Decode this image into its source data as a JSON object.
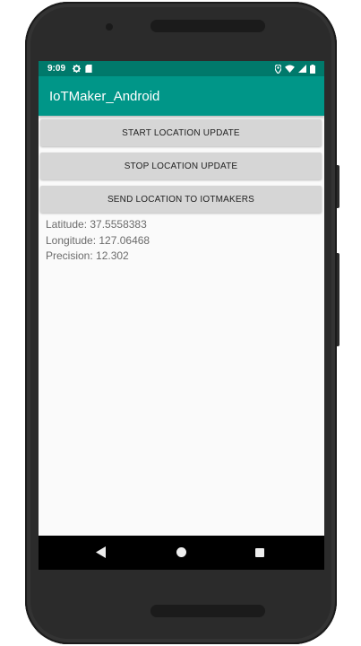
{
  "status_bar": {
    "time": "9:09",
    "left_icons": [
      "gear-icon",
      "sd-card-icon"
    ],
    "right_icons": [
      "location-pin-icon",
      "wifi-icon",
      "cell-signal-icon",
      "battery-icon"
    ]
  },
  "app_bar": {
    "title": "IoTMaker_Android"
  },
  "buttons": {
    "start": "START LOCATION UPDATE",
    "stop": "STOP LOCATION UPDATE",
    "send": "SEND LOCATION TO IOTMAKERS"
  },
  "location": {
    "latitude": "Latitude: 37.5558383",
    "longitude": "Longitude: 127.06468",
    "precision": "Precision: 12.302"
  },
  "nav_bar": {
    "icons": [
      "back-icon",
      "home-icon",
      "recent-apps-icon"
    ]
  },
  "colors": {
    "primary": "#009688",
    "primary_dark": "#00796b",
    "button_bg": "#d6d6d6",
    "screen_bg": "#fafafa"
  }
}
